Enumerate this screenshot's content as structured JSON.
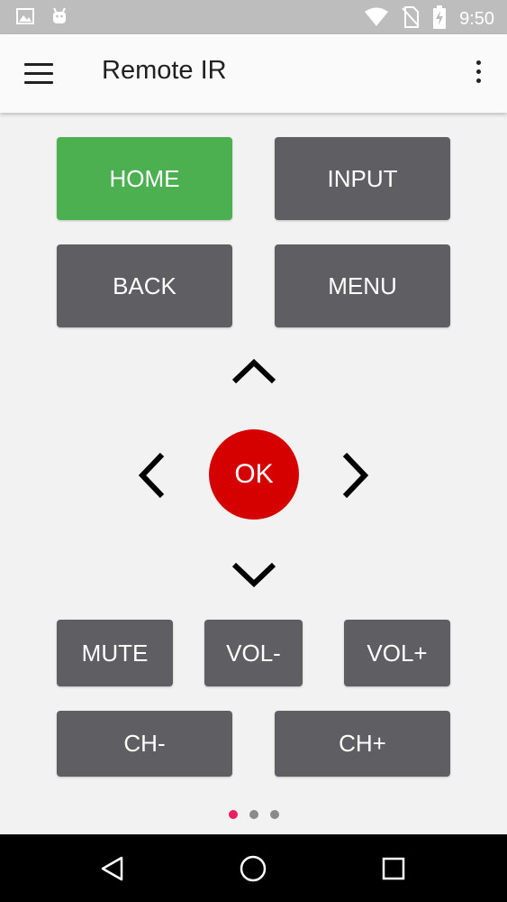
{
  "status_bar": {
    "time": "9:50",
    "icons": [
      "image-icon",
      "android-icon",
      "wifi-icon",
      "no-sim-icon",
      "battery-charging-icon"
    ]
  },
  "app_bar": {
    "title": "Remote IR",
    "menu_icon": "hamburger-menu-icon",
    "overflow_icon": "more-vert-icon"
  },
  "buttons": {
    "home": "HOME",
    "input": "INPUT",
    "back": "BACK",
    "menu": "MENU",
    "ok": "OK",
    "mute": "MUTE",
    "vol_down": "VOL-",
    "vol_up": "VOL+",
    "ch_down": "CH-",
    "ch_up": "CH+"
  },
  "dpad": {
    "up": "chevron-up-icon",
    "down": "chevron-down-icon",
    "left": "chevron-left-icon",
    "right": "chevron-right-icon"
  },
  "pager": {
    "pages": 3,
    "active_index": 0
  },
  "nav_bar": {
    "items": [
      "back-icon",
      "home-icon",
      "recents-icon"
    ]
  },
  "colors": {
    "home_button": "#4caf50",
    "default_button": "#5f5e62",
    "ok_button": "#d50000",
    "pager_active": "#e91e63",
    "background": "#f2f2f2"
  }
}
